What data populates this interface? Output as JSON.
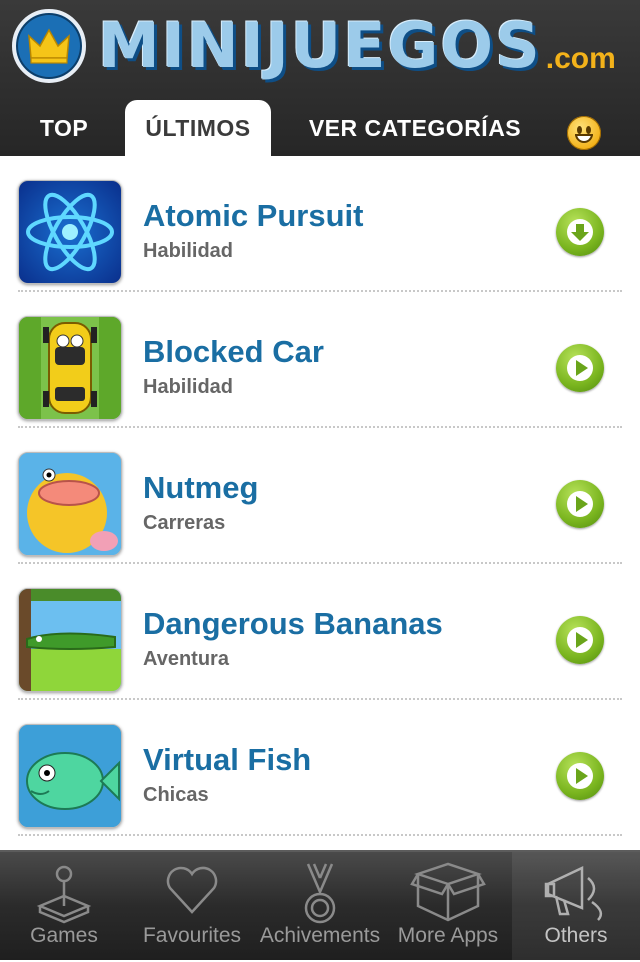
{
  "header": {
    "logo_text": "MINIJUEGOS",
    "logo_suffix": ".com"
  },
  "tabs": [
    {
      "label": "TOP",
      "active": false
    },
    {
      "label": "ÚLTIMOS",
      "active": true
    },
    {
      "label": "VER CATEGORÍAS",
      "active": false
    }
  ],
  "games": [
    {
      "title": "Atomic Pursuit",
      "category": "Habilidad",
      "icon": "atom-icon",
      "action": "download-icon"
    },
    {
      "title": "Blocked Car",
      "category": "Habilidad",
      "icon": "car-icon",
      "action": "play-icon"
    },
    {
      "title": "Nutmeg",
      "category": "Carreras",
      "icon": "chick-icon",
      "action": "play-icon"
    },
    {
      "title": "Dangerous Bananas",
      "category": "Aventura",
      "icon": "crocodile-icon",
      "action": "play-icon"
    },
    {
      "title": "Virtual Fish",
      "category": "Chicas",
      "icon": "fish-icon",
      "action": "play-icon"
    }
  ],
  "tabbar": [
    {
      "label": "Games",
      "icon": "joystick-icon"
    },
    {
      "label": "Favourites",
      "icon": "heart-icon"
    },
    {
      "label": "Achivements",
      "icon": "medal-icon"
    },
    {
      "label": "More Apps",
      "icon": "box-icon"
    },
    {
      "label": "Others",
      "icon": "megaphone-icon",
      "selected": true
    }
  ],
  "colors": {
    "title_blue": "#1a6ea3",
    "play_green": "#7ab51f",
    "header_bg": "#2a2a2a"
  }
}
